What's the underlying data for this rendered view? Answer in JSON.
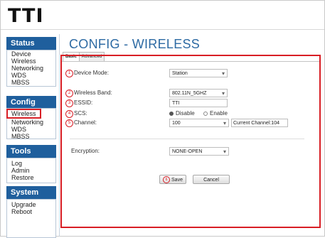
{
  "app": {
    "logo": "TTI"
  },
  "sidebar": {
    "sections": [
      {
        "title": "Status",
        "items": [
          "Device",
          "Wireless",
          "Networking",
          "WDS",
          "MBSS"
        ]
      },
      {
        "title": "Config",
        "items": [
          "Wireless",
          "Networking",
          "WDS",
          "MBSS"
        ],
        "active_index": 0
      },
      {
        "title": "Tools",
        "items": [
          "Log",
          "Admin",
          "Restore"
        ]
      },
      {
        "title": "System",
        "items": [
          "Upgrade",
          "Reboot"
        ]
      }
    ]
  },
  "main": {
    "title": "CONFIG - WIRELESS",
    "tabs": [
      {
        "label": "Basic",
        "active": true
      },
      {
        "label": "Advanced",
        "active": false
      }
    ],
    "form": {
      "device_mode": {
        "marker": "1",
        "label": "Device Mode:",
        "value": "Station"
      },
      "wireless_band": {
        "marker": "2",
        "label": "Wireless Band:",
        "value": "802.11N_5GHZ"
      },
      "essid": {
        "marker": "3",
        "label": "ESSID:",
        "value": "TTI"
      },
      "scs": {
        "marker": "4",
        "label": "SCS:",
        "options": [
          "Disable",
          "Enable"
        ],
        "selected": "Disable"
      },
      "channel": {
        "marker": "5",
        "label": "Channel:",
        "value": "100",
        "current": "Current Channel:104"
      },
      "encryption": {
        "label": "Encryption:",
        "value": "NONE-OPEN"
      }
    },
    "buttons": {
      "marker": "6",
      "save": "Save",
      "cancel": "Cancel"
    }
  },
  "colors": {
    "accent": "#1f5f9d",
    "title": "#2d6aa3",
    "highlight": "#d81e25"
  }
}
